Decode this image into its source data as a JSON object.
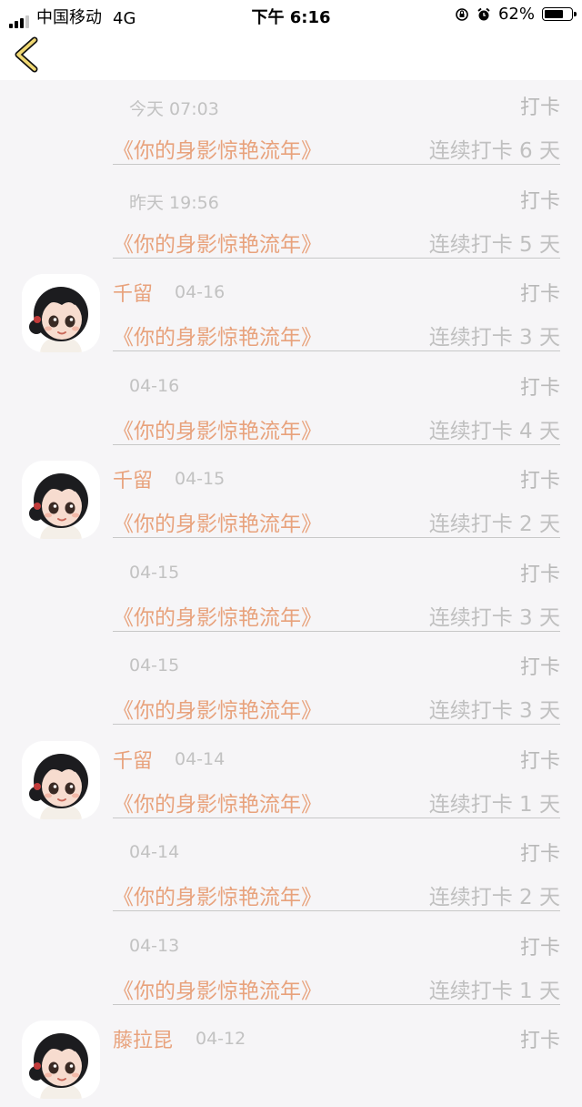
{
  "status": {
    "carrier": "中国移动",
    "network": "4G",
    "time": "下午 6:16",
    "battery": "62%",
    "battery_level": 0.62
  },
  "nav": {
    "back_icon": "chevron-left-icon",
    "accent": "#f0d873"
  },
  "colors": {
    "accent": "#e8a27c",
    "muted": "#c0c0c0",
    "background": "#f6f5f7"
  },
  "items": [
    {
      "avatar": false,
      "name": "",
      "time": "今天 07:03",
      "tag": "打卡",
      "book": "《你的身影惊艳流年》",
      "streak": "连续打卡 6 天"
    },
    {
      "avatar": false,
      "name": "",
      "time": "昨天 19:56",
      "tag": "打卡",
      "book": "《你的身影惊艳流年》",
      "streak": "连续打卡 5 天"
    },
    {
      "avatar": true,
      "name": "千留",
      "time": "04-16",
      "tag": "打卡",
      "book": "《你的身影惊艳流年》",
      "streak": "连续打卡 3 天"
    },
    {
      "avatar": false,
      "name": "",
      "time": "04-16",
      "tag": "打卡",
      "book": "《你的身影惊艳流年》",
      "streak": "连续打卡 4 天"
    },
    {
      "avatar": true,
      "name": "千留",
      "time": "04-15",
      "tag": "打卡",
      "book": "《你的身影惊艳流年》",
      "streak": "连续打卡 2 天"
    },
    {
      "avatar": false,
      "name": "",
      "time": "04-15",
      "tag": "打卡",
      "book": "《你的身影惊艳流年》",
      "streak": "连续打卡 3 天"
    },
    {
      "avatar": false,
      "name": "",
      "time": "04-15",
      "tag": "打卡",
      "book": "《你的身影惊艳流年》",
      "streak": "连续打卡 3 天"
    },
    {
      "avatar": true,
      "name": "千留",
      "time": "04-14",
      "tag": "打卡",
      "book": "《你的身影惊艳流年》",
      "streak": "连续打卡 1 天"
    },
    {
      "avatar": false,
      "name": "",
      "time": "04-14",
      "tag": "打卡",
      "book": "《你的身影惊艳流年》",
      "streak": "连续打卡 2 天"
    },
    {
      "avatar": false,
      "name": "",
      "time": "04-13",
      "tag": "打卡",
      "book": "《你的身影惊艳流年》",
      "streak": "连续打卡 1 天"
    },
    {
      "avatar": true,
      "name": "藤拉昆",
      "time": "04-12",
      "tag": "打卡",
      "book": "",
      "streak": ""
    }
  ]
}
